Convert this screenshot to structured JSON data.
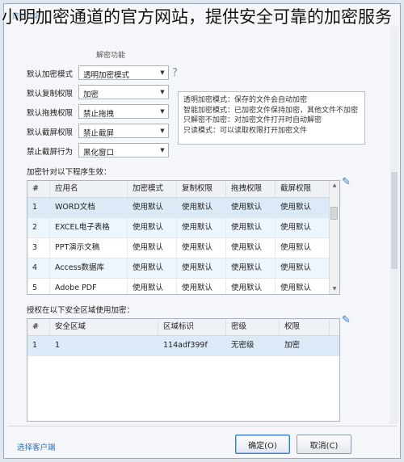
{
  "overlay_title": "小明加密通道的官方网站，提供安全可靠的加密服务",
  "tabs": [
    "策略内容"
  ],
  "subtab": "解密功能",
  "settings": [
    {
      "label": "默认加密模式",
      "value": "透明加密模式"
    },
    {
      "label": "默认复制权限",
      "value": "加密"
    },
    {
      "label": "默认拖拽权限",
      "value": "禁止拖拽"
    },
    {
      "label": "默认截屏权限",
      "value": "禁止截屏"
    },
    {
      "label": "禁止截屏行为",
      "value": "黑化窗口"
    }
  ],
  "help_glyph": "?",
  "description": [
    "透明加密模式：保存的文件会自动加密",
    "智能加密模式：已加密文件保持加密，其他文件不加密",
    "只解密不加密：对加密文件打开时自动解密",
    "只读模式：可以读取权限打开加密文件"
  ],
  "programs": {
    "label": "加密针对以下程序生效：",
    "columns": [
      "#",
      "应用名",
      "加密模式",
      "复制权限",
      "拖拽权限",
      "截屏权限"
    ],
    "rows": [
      [
        "1",
        "WORD文档",
        "使用默认",
        "使用默认",
        "使用默认",
        "使用默认"
      ],
      [
        "2",
        "EXCEL电子表格",
        "使用默认",
        "使用默认",
        "使用默认",
        "使用默认"
      ],
      [
        "3",
        "PPT演示文稿",
        "使用默认",
        "使用默认",
        "使用默认",
        "使用默认"
      ],
      [
        "4",
        "Access数据库",
        "使用默认",
        "使用默认",
        "使用默认",
        "使用默认"
      ],
      [
        "5",
        "Adobe PDF",
        "使用默认",
        "使用默认",
        "使用默认",
        "使用默认"
      ]
    ]
  },
  "areas": {
    "label": "授权在以下安全区域使用加密：",
    "columns": [
      "#",
      "安全区域",
      "区域标识",
      "密级",
      "权限"
    ],
    "rows": [
      [
        "1",
        "1",
        "114adf399f",
        "无密级",
        "加密"
      ]
    ]
  },
  "footer": {
    "link": "选择客户端",
    "ok": "确定(O)",
    "cancel": "取消(C)"
  },
  "colors": {
    "accent": "#2a7ac9",
    "selected_row": "#dceaf8"
  }
}
